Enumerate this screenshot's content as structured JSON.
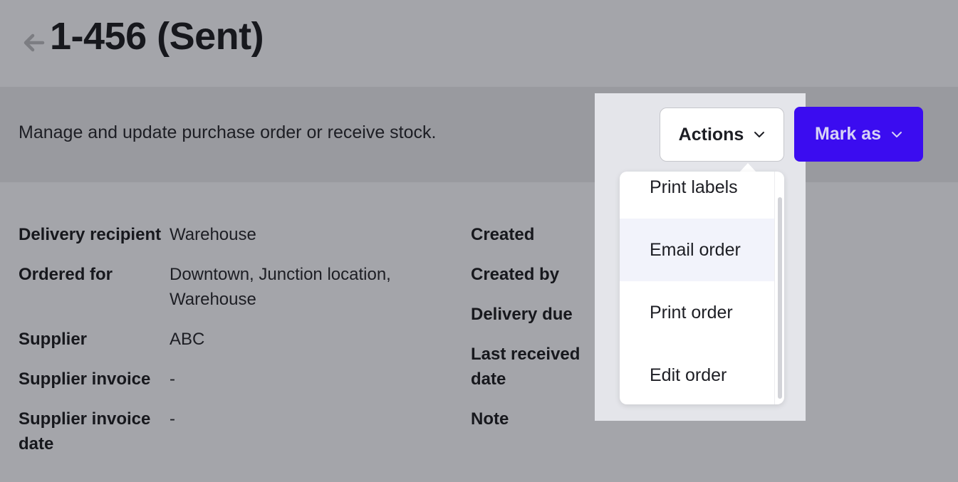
{
  "header": {
    "title": "1-456 (Sent)",
    "back_icon": "arrow-left-icon"
  },
  "subheader": {
    "description": "Manage and update purchase order or receive stock."
  },
  "toolbar": {
    "actions_label": "Actions",
    "mark_as_label": "Mark as",
    "chevron_icon": "chevron-down-icon",
    "mark_as_color": "#3b0cf0"
  },
  "actions_menu": {
    "items": [
      {
        "label": "Print labels"
      },
      {
        "label": "Email order"
      },
      {
        "label": "Print order"
      },
      {
        "label": "Edit order"
      }
    ],
    "hovered_item": "Email order"
  },
  "details_left": [
    {
      "label": "Delivery recipient",
      "value": "Warehouse"
    },
    {
      "label": "Ordered for",
      "value": "Downtown, Junction location,",
      "value_line2": "Warehouse"
    },
    {
      "label": "Supplier",
      "value": "ABC"
    },
    {
      "label": "Supplier invoice",
      "value": "-"
    },
    {
      "label": "Supplier invoice",
      "label_line2": "date",
      "value": "-"
    }
  ],
  "details_right": [
    {
      "label": "Created"
    },
    {
      "label": "Created by"
    },
    {
      "label": "Delivery due"
    },
    {
      "label": "Last received",
      "label_line2": "date"
    },
    {
      "label": "Note"
    }
  ]
}
